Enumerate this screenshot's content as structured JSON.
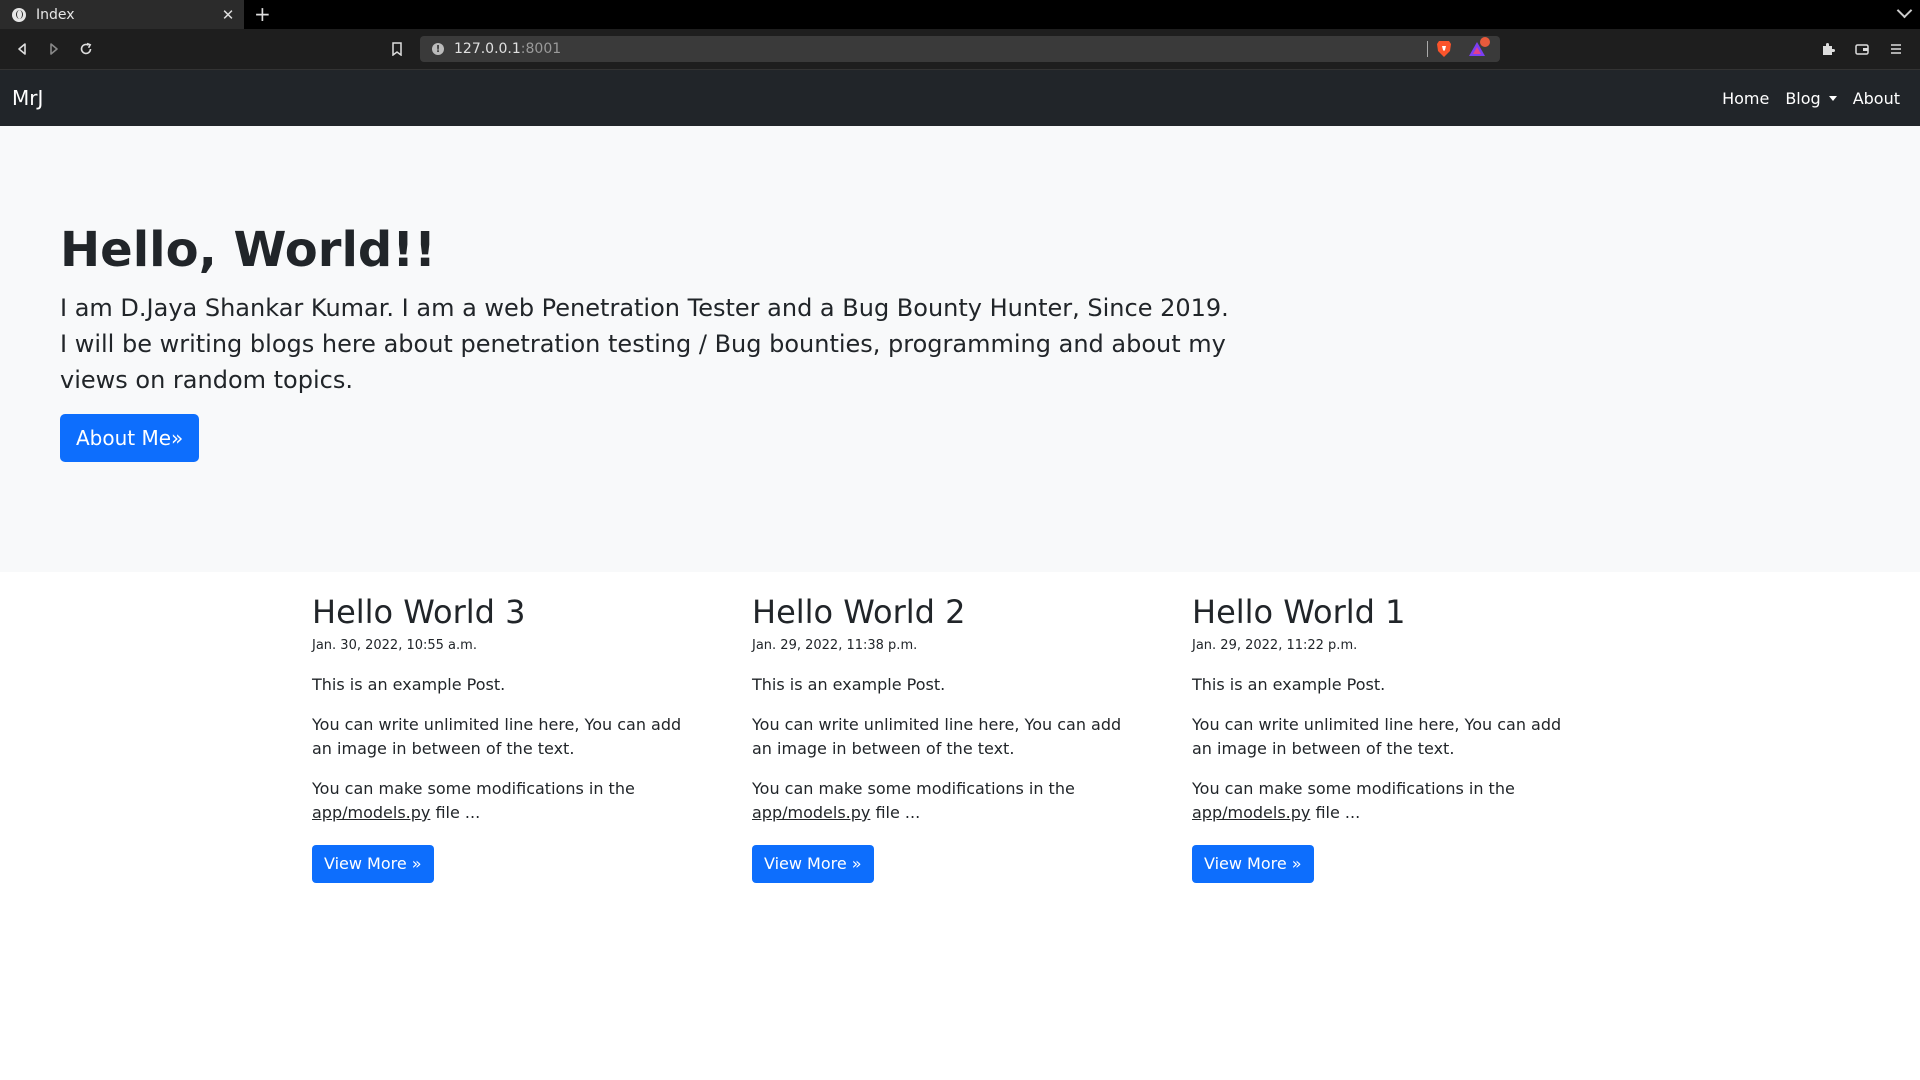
{
  "browser": {
    "tab_title": "Index",
    "tab_close": "✕",
    "new_tab": "+",
    "url_host": "127.0.0.1",
    "url_port": ":8001",
    "accent": "#0d6efd"
  },
  "navbar": {
    "brand": "MrJ",
    "items": [
      "Home",
      "Blog",
      "About"
    ]
  },
  "hero": {
    "title": "Hello, World!!",
    "line1": "I am D.Jaya Shankar Kumar. I am a web Penetration Tester and a Bug Bounty Hunter, Since 2019.",
    "line2": "I will be writing blogs here about penetration testing / Bug bounties, programming and about my views on random topics.",
    "button": "About Me»"
  },
  "posts": [
    {
      "title": "Hello World 3",
      "date": "Jan. 30, 2022, 10:55 a.m.",
      "p1": "This is an example Post.",
      "p2": "You can write unlimited line here, You can add an image in between of the text.",
      "p3_pre": "You can make some modifications in the",
      "p3_link": "app/models.py",
      "p3_post": " file ...",
      "button": "View More »"
    },
    {
      "title": "Hello World 2",
      "date": "Jan. 29, 2022, 11:38 p.m.",
      "p1": "This is an example Post.",
      "p2": "You can write unlimited line here, You can add an image in between of the text.",
      "p3_pre": "You can make some modifications in the",
      "p3_link": "app/models.py",
      "p3_post": " file ...",
      "button": "View More »"
    },
    {
      "title": "Hello World 1",
      "date": "Jan. 29, 2022, 11:22 p.m.",
      "p1": "This is an example Post.",
      "p2": "You can write unlimited line here, You can add an image in between of the text.",
      "p3_pre": "You can make some modifications in the",
      "p3_link": "app/models.py",
      "p3_post": " file ...",
      "button": "View More »"
    }
  ]
}
